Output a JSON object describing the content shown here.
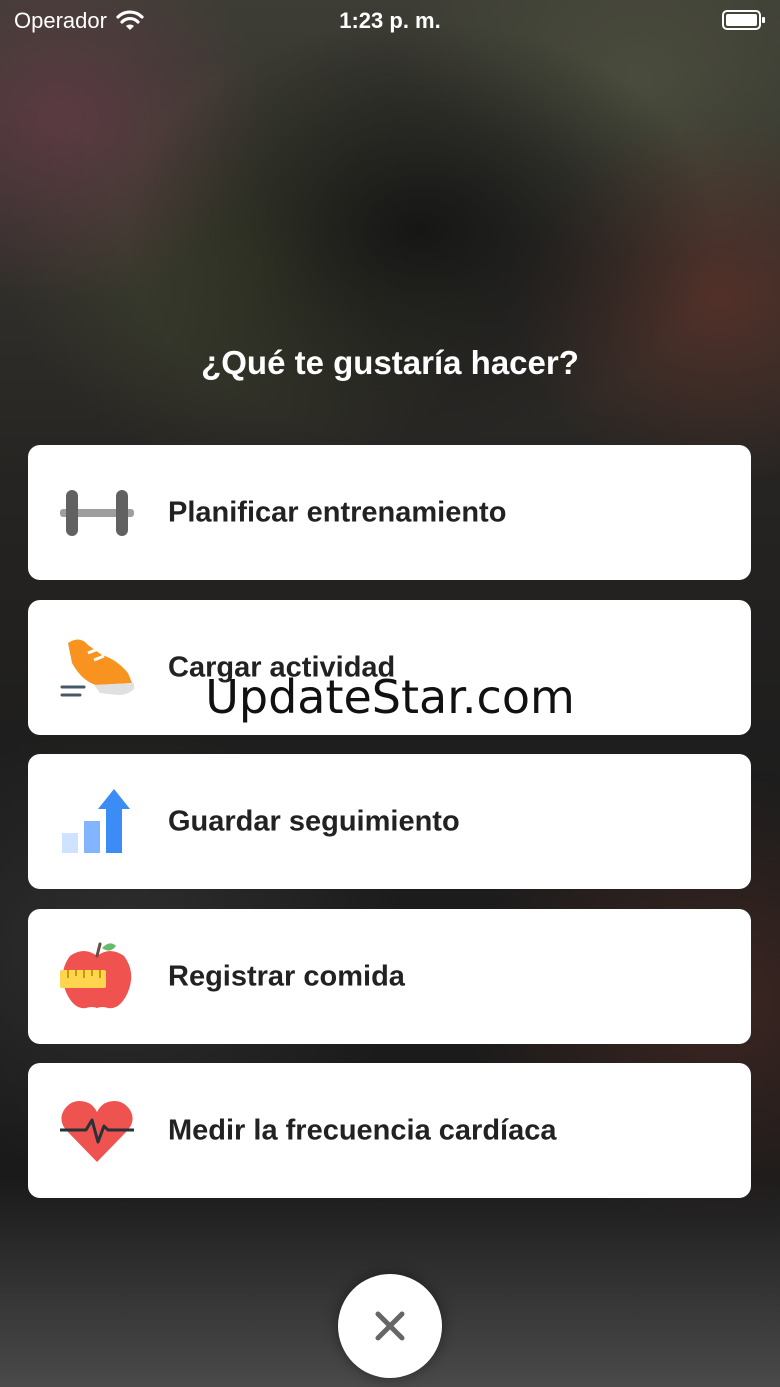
{
  "status_bar": {
    "carrier": "Operador",
    "time": "1:23 p. m."
  },
  "title": "¿Qué te gustaría hacer?",
  "options": [
    {
      "label": "Planificar entrenamiento",
      "icon": "dumbbell-icon"
    },
    {
      "label": "Cargar actividad",
      "icon": "running-shoe-icon"
    },
    {
      "label": "Guardar seguimiento",
      "icon": "progress-chart-icon"
    },
    {
      "label": "Registrar comida",
      "icon": "apple-measure-icon"
    },
    {
      "label": "Medir la frecuencia cardíaca",
      "icon": "heart-rate-icon"
    }
  ],
  "watermark": "UpdateStar.com",
  "close": {
    "icon": "close-icon"
  },
  "colors": {
    "card_bg": "#ffffff",
    "label_text": "#222222",
    "shoe_orange": "#f7931e",
    "chart_blue": "#3b8df5",
    "apple_red": "#f0524f",
    "heart_red": "#ef5350"
  }
}
